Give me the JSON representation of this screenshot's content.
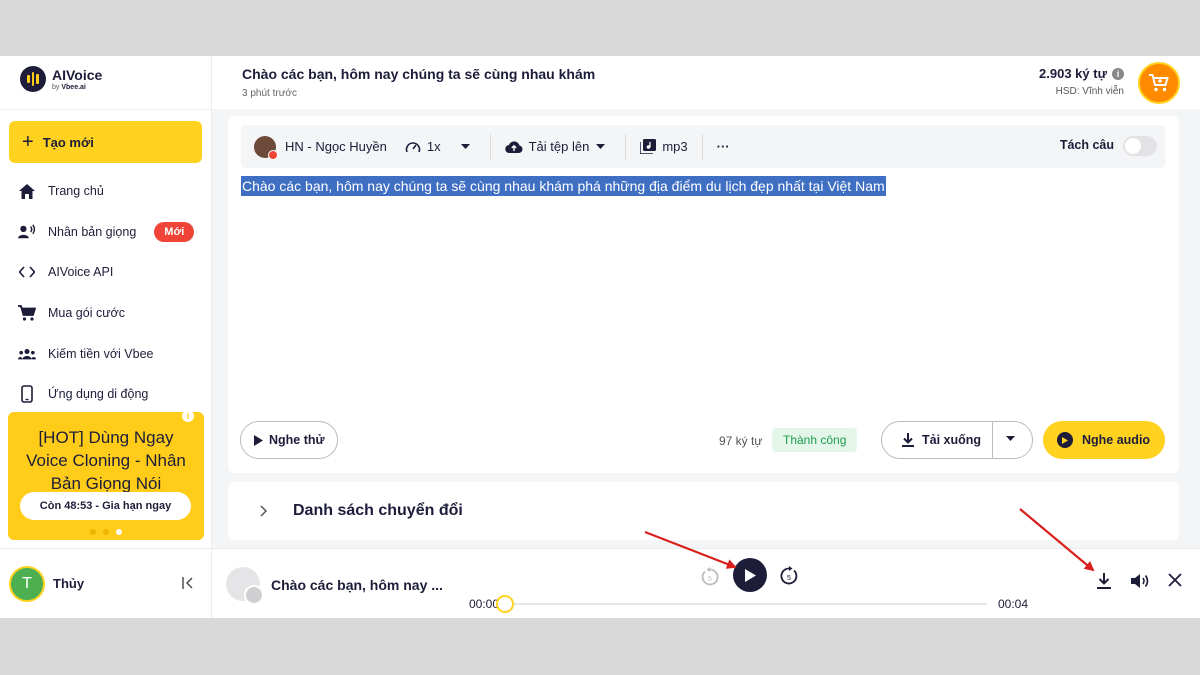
{
  "app": {
    "name": "AIVoice",
    "by": "by",
    "brand": "Vbee.ai"
  },
  "sidebar": {
    "create_label": "Tạo mới",
    "items": [
      {
        "label": "Trang chủ",
        "icon": "home-icon"
      },
      {
        "label": "Nhân bản giọng",
        "icon": "voice-clone-icon",
        "badge": "Mới"
      },
      {
        "label": "AIVoice API",
        "icon": "code-icon"
      },
      {
        "label": "Mua gói cước",
        "icon": "cart-icon"
      },
      {
        "label": "Kiếm tiền với Vbee",
        "icon": "people-icon"
      },
      {
        "label": "Ứng dụng di động",
        "icon": "phone-icon"
      }
    ],
    "promo": {
      "text": "[HOT] Dùng Ngay Voice Cloning - Nhân Bản Giọng Nói",
      "button": "Còn 48:53 - Gia hạn ngay"
    },
    "user": {
      "initial": "T",
      "name": "Thủy"
    }
  },
  "header": {
    "title": "Chào các bạn, hôm nay chúng ta sẽ cùng nhau khám",
    "time": "3 phút trước",
    "credits": "2.903 ký tự",
    "hsd": "HSD: Vĩnh viễn"
  },
  "editor": {
    "voice": "HN - Ngọc Huyền",
    "speed": "1x",
    "upload": "Tải tệp lên",
    "format": "mp3",
    "more": "···",
    "split_label": "Tách câu",
    "split_on": false,
    "text": "Chào các bạn, hôm nay chúng ta sẽ cùng nhau khám phá những địa điểm du lịch đẹp nhất tại Việt Nam",
    "preview_label": "Nghe thử",
    "char_count": "97 ký tự",
    "status": "Thành công",
    "download_label": "Tải xuống",
    "listen_label": "Nghe audio"
  },
  "list": {
    "title": "Danh sách chuyển đổi"
  },
  "player": {
    "title": "Chào các bạn, hôm nay ...",
    "time_start": "00:00",
    "time_end": "00:04",
    "progress": 0
  },
  "colors": {
    "accent": "#ffd21f",
    "primary": "#1d1d3a",
    "success": "#1e9e4a",
    "badge": "#f04438",
    "annotation": "#d9201c"
  }
}
